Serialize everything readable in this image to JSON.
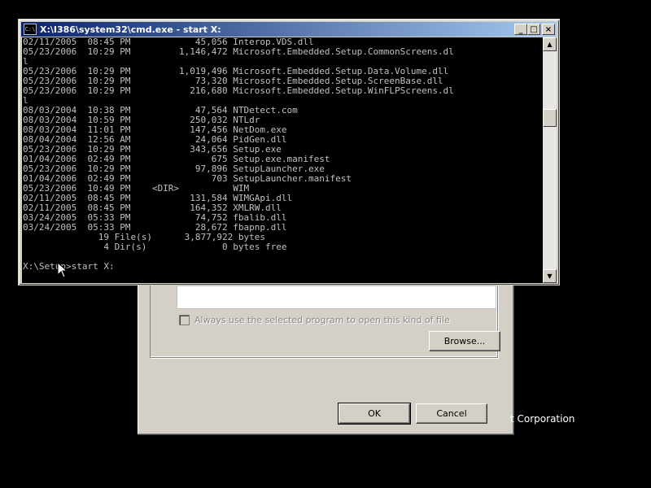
{
  "cmd": {
    "title": "X:\\I386\\system32\\cmd.exe - start X:",
    "icon_text": "C:\\",
    "lines": [
      "02/11/2005  08:45 PM            45,056 Interop.VDS.dll",
      "05/23/2006  10:29 PM         1,146,472 Microsoft.Embedded.Setup.CommonScreens.dl",
      "l",
      "05/23/2006  10:29 PM         1,019,496 Microsoft.Embedded.Setup.Data.Volume.dll",
      "05/23/2006  10:29 PM            73,320 Microsoft.Embedded.Setup.ScreenBase.dll",
      "05/23/2006  10:29 PM           216,680 Microsoft.Embedded.Setup.WinFLPScreens.dl",
      "l",
      "08/03/2004  10:38 PM            47,564 NTDetect.com",
      "08/03/2004  10:59 PM           250,032 NTLdr",
      "08/03/2004  11:01 PM           147,456 NetDom.exe",
      "08/04/2004  12:56 AM            24,064 PidGen.dll",
      "05/23/2006  10:29 PM           343,656 Setup.exe",
      "01/04/2006  02:49 PM               675 Setup.exe.manifest",
      "05/23/2006  10:29 PM            97,896 SetupLauncher.exe",
      "01/04/2006  02:49 PM               703 SetupLauncher.manifest",
      "05/23/2006  10:49 PM    <DIR>          WIM",
      "02/11/2005  08:45 PM           131,584 WIMGApi.dll",
      "02/11/2005  08:45 PM           164,352 XMLRW.dll",
      "03/24/2005  05:33 PM            74,752 fbalib.dll",
      "03/24/2005  05:33 PM            28,672 fbapnp.dll",
      "              19 File(s)      3,877,922 bytes",
      "               4 Dir(s)              0 bytes free"
    ],
    "prompt": "X:\\Setup>start X:",
    "controls": {
      "minimize": "_",
      "maximize": "□",
      "close": "×"
    },
    "scroll": {
      "up": "▲",
      "down": "▼"
    }
  },
  "dialog": {
    "checkbox_label": "Always use the selected program to open this kind of file",
    "browse_label": "Browse...",
    "ok_label": "OK",
    "cancel_label": "Cancel"
  },
  "background": {
    "corp_text": "t Corporation"
  }
}
